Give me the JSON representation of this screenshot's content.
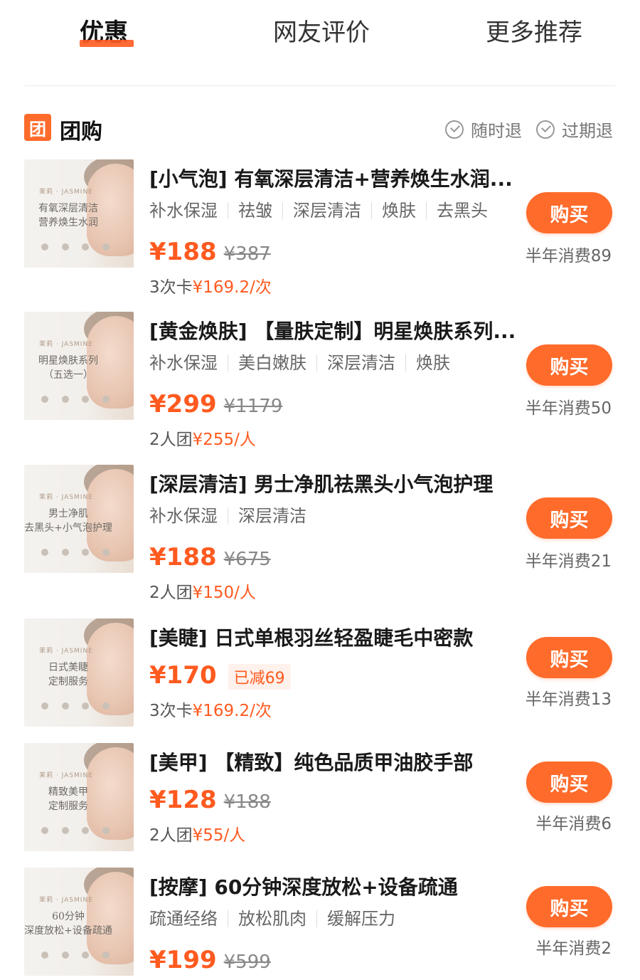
{
  "tabs": [
    {
      "label": "优惠",
      "active": true
    },
    {
      "label": "网友评价",
      "active": false
    },
    {
      "label": "更多推荐",
      "active": false
    }
  ],
  "section": {
    "icon_text": "团",
    "title": "团购",
    "policies": [
      "随时退",
      "过期退"
    ]
  },
  "buy_label": "购买",
  "deals": [
    {
      "title": "[小气泡] 有氧深层清洁+营养焕生水润...",
      "tags": [
        "补水保湿",
        "祛皱",
        "深层清洁",
        "焕肤",
        "去黑头"
      ],
      "price": "¥188",
      "original_price": "¥387",
      "reduced": "",
      "extra_prefix": "3次卡",
      "extra_value": "¥169.2/次",
      "sold": "半年消费89",
      "thumb": {
        "brand": "茉莉 · JASMINE",
        "line1": "有氧深层清洁",
        "line2": "营养焕生水润"
      }
    },
    {
      "title": "[黄金焕肤] 【量肤定制】明星焕肤系列...",
      "tags": [
        "补水保湿",
        "美白嫩肤",
        "深层清洁",
        "焕肤"
      ],
      "price": "¥299",
      "original_price": "¥1179",
      "reduced": "",
      "extra_prefix": "2人团",
      "extra_value": "¥255/人",
      "sold": "半年消费50",
      "thumb": {
        "brand": "茉莉 · JASMINE",
        "line1": "明星焕肤系列",
        "line2": "（五选一）"
      }
    },
    {
      "title": "[深层清洁] 男士净肌祛黑头小气泡护理",
      "tags": [
        "补水保湿",
        "深层清洁"
      ],
      "price": "¥188",
      "original_price": "¥675",
      "reduced": "",
      "extra_prefix": "2人团",
      "extra_value": "¥150/人",
      "sold": "半年消费21",
      "thumb": {
        "brand": "茉莉 · JASMINE",
        "line1": "男士净肌",
        "line2": "去黑头+小气泡护理"
      }
    },
    {
      "title": "[美睫] 日式单根羽丝轻盈睫毛中密款",
      "tags": [],
      "price": "¥170",
      "original_price": "",
      "reduced": "已减69",
      "extra_prefix": "3次卡",
      "extra_value": "¥169.2/次",
      "sold": "半年消费13",
      "thumb": {
        "brand": "茉莉 · JASMINE",
        "line1": "日式美睫",
        "line2": "定制服务"
      }
    },
    {
      "title": "[美甲] 【精致】纯色品质甲油胶手部",
      "tags": [],
      "price": "¥128",
      "original_price": "¥188",
      "reduced": "",
      "extra_prefix": "2人团",
      "extra_value": "¥55/人",
      "sold": "半年消费6",
      "thumb": {
        "brand": "茉莉 · JASMINE",
        "line1": "精致美甲",
        "line2": "定制服务"
      }
    },
    {
      "title": "[按摩] 60分钟深度放松+设备疏通",
      "tags": [
        "疏通经络",
        "放松肌肉",
        "缓解压力"
      ],
      "price": "¥199",
      "original_price": "¥599",
      "reduced": "",
      "extra_prefix": "",
      "extra_value": "",
      "sold": "半年消费2",
      "thumb": {
        "brand": "茉莉 · JASMINE",
        "line1": "60分钟",
        "line2": "深度放松+设备疏通"
      }
    }
  ]
}
